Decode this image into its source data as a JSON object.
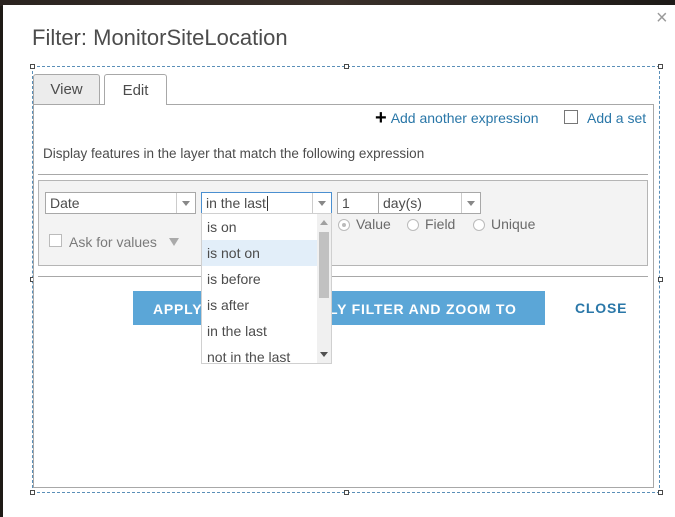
{
  "dialog": {
    "title": "Filter: MonitorSiteLocation",
    "close_glyph": "×"
  },
  "tabs": [
    {
      "label": "View",
      "active": false
    },
    {
      "label": "Edit",
      "active": true
    }
  ],
  "toolbar": {
    "add_expression_icon": "plus-icon",
    "add_expression_label": "Add another expression",
    "add_set_label": "Add a set",
    "add_set_checked": false
  },
  "description": "Display features in the layer that match the following expression",
  "expression": {
    "field": "Date",
    "operator": "in the last",
    "number": "1",
    "unit": "day(s)",
    "value_types": [
      {
        "label": "Value",
        "selected": true
      },
      {
        "label": "Field",
        "selected": false
      },
      {
        "label": "Unique",
        "selected": false
      }
    ],
    "ask_for_values_label": "Ask for values",
    "ask_for_values_checked": false
  },
  "operator_dropdown": {
    "options": [
      "is on",
      "is not on",
      "is before",
      "is after",
      "in the last",
      "not in the last"
    ],
    "highlighted": "is not on"
  },
  "buttons": {
    "apply_visible": "APPLY",
    "apply_zoom_visible": "LY FILTER AND ZOOM TO",
    "close": "CLOSE"
  },
  "colors": {
    "accent": "#5ba6d7",
    "link": "#2a77a8",
    "highlight": "#e2eef9"
  }
}
